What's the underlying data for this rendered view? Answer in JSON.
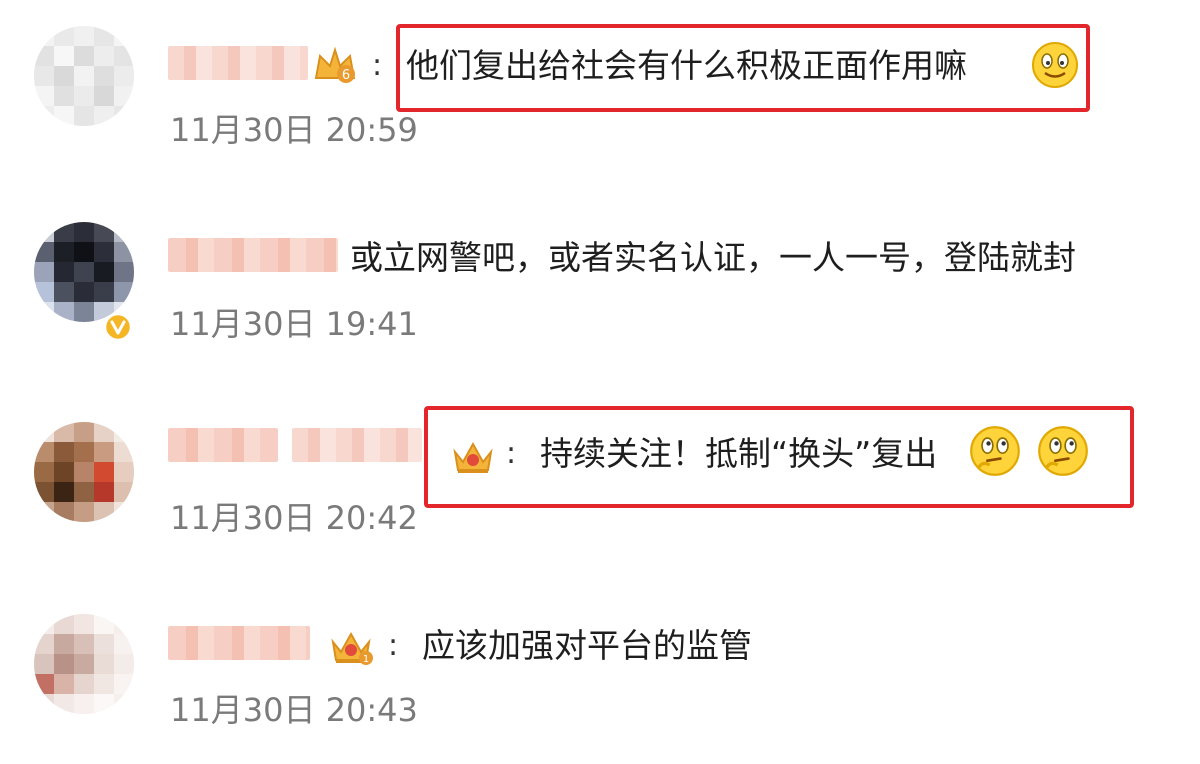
{
  "colors": {
    "highlight_border": "#e2262b",
    "timestamp": "#7a7a7a",
    "comment_text": "#1e1e1e",
    "name_blur": "#f2b9a9",
    "badge_gold": "#f4b43a",
    "emoji_yellow": "#ffd43b"
  },
  "comments": [
    {
      "separator": ":",
      "text": "他们复出给社会有什么积极正面作用嘛",
      "time": "11月30日 20:59",
      "badge": "level-6-badge-icon",
      "emojis": [
        "smiling-emoji-icon"
      ],
      "highlighted": true
    },
    {
      "separator": "",
      "text": "或立网警吧，或者实名认证，一人一号，登陆就封",
      "time": "11月30日 19:41",
      "badge": "verified-v-icon",
      "emojis": [],
      "highlighted": false
    },
    {
      "separator": ":",
      "text": "持续关注！抵制“换头”复出",
      "time": "11月30日 20:42",
      "badge": "crown-badge-icon",
      "emojis": [
        "thinking-emoji-icon",
        "thinking-emoji-icon"
      ],
      "highlighted": true
    },
    {
      "separator": ":",
      "text": "应该加强对平台的监管",
      "time": "11月30日 20:43",
      "badge": "crown-level-1-badge-icon",
      "emojis": [],
      "highlighted": false
    }
  ]
}
